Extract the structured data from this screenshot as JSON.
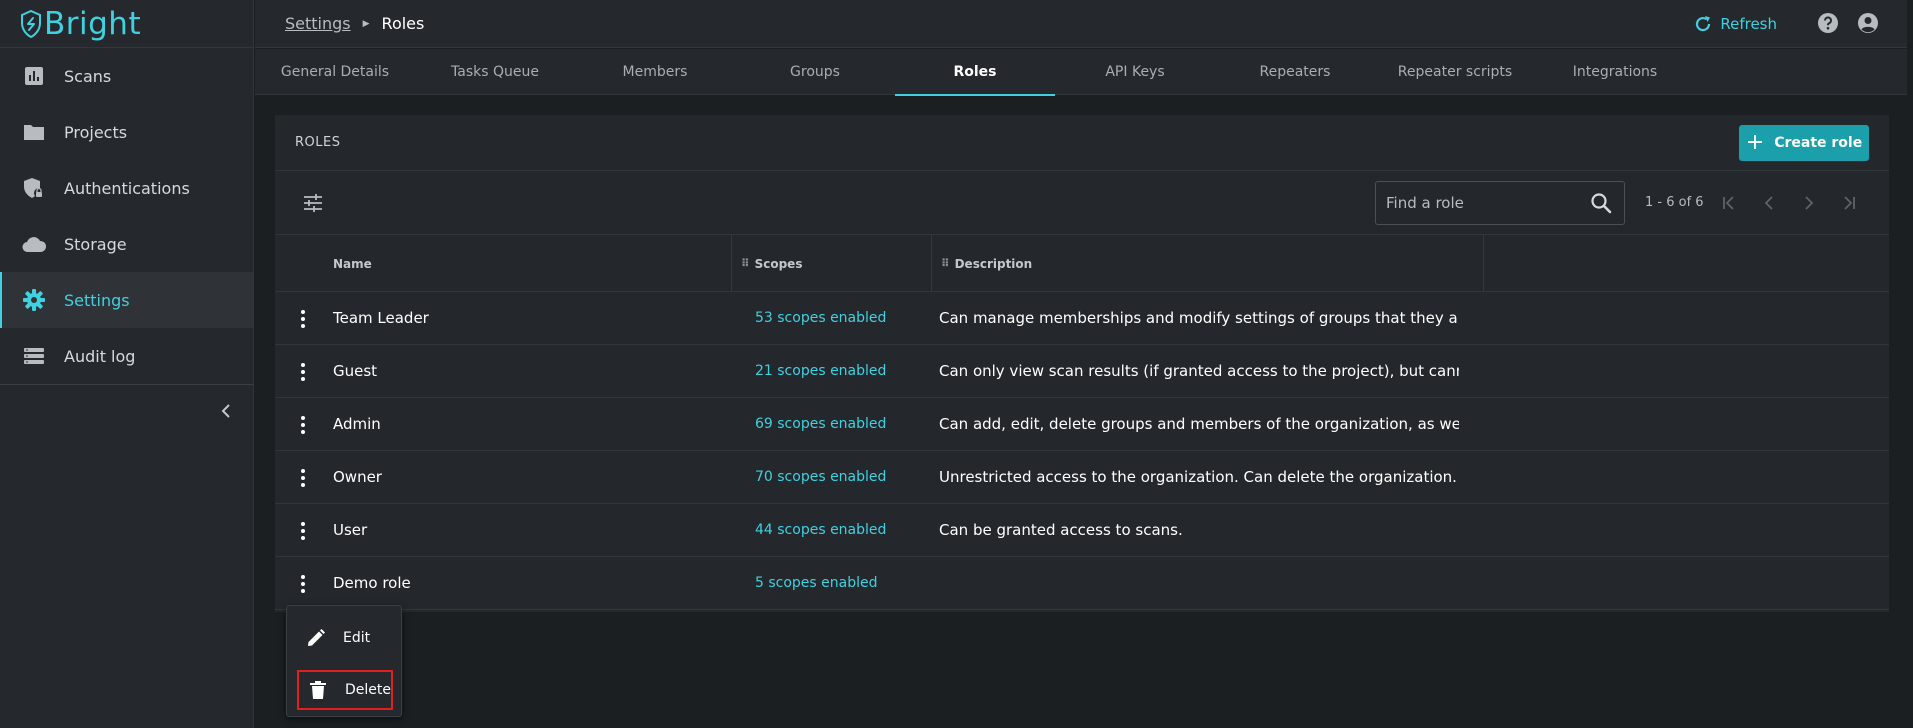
{
  "app": {
    "brand": "Bright",
    "accent_color": "#3fd1e0"
  },
  "sidebar": {
    "items": [
      {
        "label": "Scans",
        "icon": "bar-chart-icon"
      },
      {
        "label": "Projects",
        "icon": "folder-icon"
      },
      {
        "label": "Authentications",
        "icon": "shield-lock-icon"
      },
      {
        "label": "Storage",
        "icon": "cloud-icon"
      },
      {
        "label": "Settings",
        "icon": "gear-icon",
        "active": true
      },
      {
        "label": "Audit log",
        "icon": "list-icon"
      }
    ]
  },
  "header": {
    "breadcrumb_parent": "Settings",
    "breadcrumb_current": "Roles",
    "refresh_label": "Refresh"
  },
  "tabs": [
    {
      "label": "General Details"
    },
    {
      "label": "Tasks Queue"
    },
    {
      "label": "Members"
    },
    {
      "label": "Groups"
    },
    {
      "label": "Roles",
      "active": true
    },
    {
      "label": "API Keys"
    },
    {
      "label": "Repeaters"
    },
    {
      "label": "Repeater scripts"
    },
    {
      "label": "Integrations"
    }
  ],
  "panel": {
    "title": "ROLES",
    "create_label": "Create role",
    "search_placeholder": "Find a role",
    "pagination": "1 - 6 of 6"
  },
  "table": {
    "columns": [
      "Name",
      "Scopes",
      "Description"
    ],
    "rows": [
      {
        "name": "Team Leader",
        "scopes": "53 scopes enabled",
        "description": "Can manage memberships and modify settings of groups that they are members of"
      },
      {
        "name": "Guest",
        "scopes": "21 scopes enabled",
        "description": "Can only view scan results (if granted access to the project), but cannot create or delete"
      },
      {
        "name": "Admin",
        "scopes": "69 scopes enabled",
        "description": "Can add, edit, delete groups and members of the organization, as well as make billing"
      },
      {
        "name": "Owner",
        "scopes": "70 scopes enabled",
        "description": "Unrestricted access to the organization. Can delete the organization."
      },
      {
        "name": "User",
        "scopes": "44 scopes enabled",
        "description": "Can be granted access to scans."
      },
      {
        "name": "Demo role",
        "scopes": "5 scopes enabled",
        "description": ""
      }
    ]
  },
  "context_menu": {
    "edit_label": "Edit",
    "delete_label": "Delete"
  }
}
